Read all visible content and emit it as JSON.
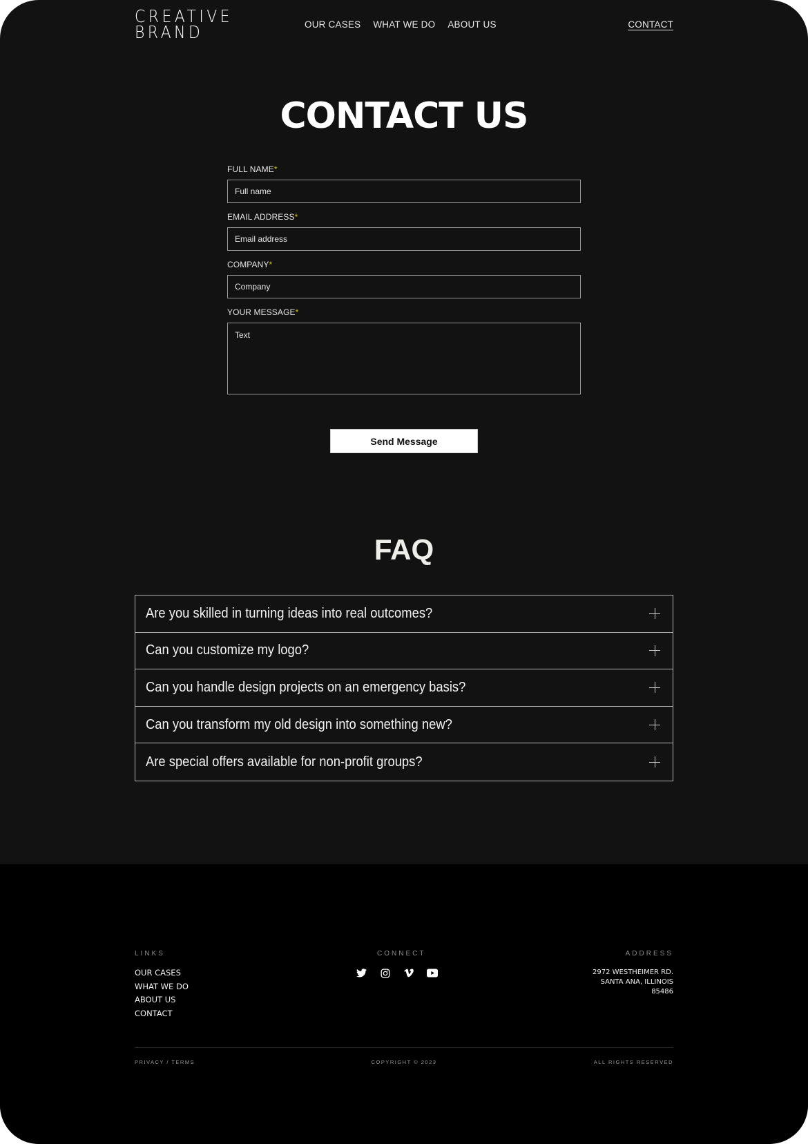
{
  "header": {
    "logo_line1": "CREATIVE",
    "logo_line2": "BRAND",
    "nav": [
      "OUR CASES",
      "WHAT WE DO",
      "ABOUT US"
    ],
    "contact": "CONTACT"
  },
  "contact": {
    "title": "CONTACT US",
    "required_mark": "*",
    "fields": [
      {
        "label": "FULL  NAME",
        "placeholder": "Full  name"
      },
      {
        "label": "EMAIL ADDRESS",
        "placeholder": "Email address"
      },
      {
        "label": "COMPANY",
        "placeholder": "Company"
      },
      {
        "label": "YOUR MESSAGE",
        "placeholder": "Text"
      }
    ],
    "submit": "Send Message",
    "accent_color": "#d8c400"
  },
  "faq": {
    "title": "FAQ",
    "items": [
      "Are you skilled in turning ideas into real outcomes?",
      "Can you customize my logo?",
      "Can you handle design projects on an emergency basis?",
      "Can you transform my old design into something new?",
      "Are special offers available for non-profit groups?"
    ]
  },
  "footer": {
    "links_heading": "LINKS",
    "links": [
      "OUR CASES",
      "WHAT WE DO",
      "ABOUT US",
      "CONTACT"
    ],
    "connect_heading": "CONNECT",
    "socials": [
      "twitter-icon",
      "instagram-icon",
      "vimeo-icon",
      "youtube-icon"
    ],
    "address_heading": "ADDRESS",
    "address_lines": [
      "2972 WESTHEIMER RD.",
      "SANTA ANA, ILLINOIS",
      "85486"
    ],
    "privacy": "PRIVACY / TERMS",
    "copyright": "COPYRIGHT © 2023",
    "rights": "ALL RIGHTS RESERVED"
  }
}
